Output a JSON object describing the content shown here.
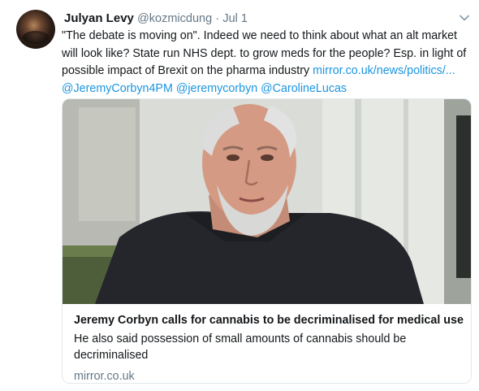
{
  "tweet": {
    "name": "Julyan Levy",
    "handle": "@kozmicdung",
    "separator": "·",
    "time": "Jul 1",
    "text_main": "\"The debate is moving on\". Indeed we need to think about what an alt market will look like? State run NHS dept. to grow meds for the people? Esp. in light of possible impact of Brexit on the pharma industry ",
    "link": "mirror.co.uk/news/politics/...",
    "mentions": [
      "@JeremyCorbyn4PM",
      "@jeremycorbyn",
      "@CarolineLucas"
    ]
  },
  "card": {
    "title": "Jeremy Corbyn calls for cannabis to be decriminalised for medical use",
    "description": "He also said possession of small amounts of cannabis should be decriminalised",
    "domain": "mirror.co.uk"
  },
  "colors": {
    "link": "#1b95e0",
    "secondary_text": "#657786",
    "border": "#e1e8ed"
  },
  "icons": [
    "avatar",
    "chevron-down-icon"
  ]
}
